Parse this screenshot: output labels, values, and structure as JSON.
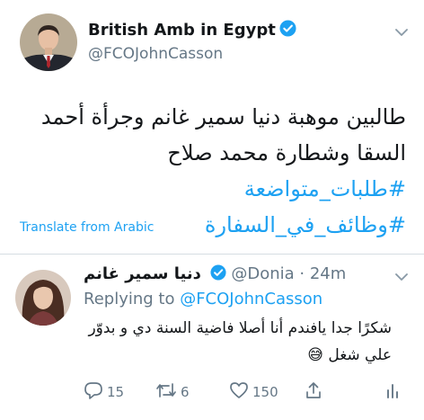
{
  "tweet": {
    "author_name": "British Amb in Egypt",
    "author_handle": "@FCOJohnCasson",
    "verified_icon": "verified-badge-icon",
    "body_line1": "طالبين موهبة دنيا سمير غانم وجرأة أحمد",
    "body_line2_text": "السقا وشطارة محمد صلاح ",
    "hashtag1": "#طلبات_متواضعة",
    "hashtag2": "#وظائف_في_السفارة",
    "translate_label": "Translate from Arabic"
  },
  "reply": {
    "author_name": "دنيا سمير غانم",
    "author_handle": "@Donia",
    "separator": " · ",
    "time": "24m",
    "replying_prefix": "Replying to ",
    "replying_mention": "@FCOJohnCasson",
    "body_line1": "شكرًا جدا يافندم أنا أصلا فاضية السنة دي و بدوّر",
    "body_line2": "علي شغل 😅",
    "actions": {
      "reply_count": "15",
      "retweet_count": "6",
      "like_count": "150"
    }
  },
  "colors": {
    "accent": "#1da1f2",
    "secondary_text": "#657786",
    "divider": "#d6dde3"
  }
}
